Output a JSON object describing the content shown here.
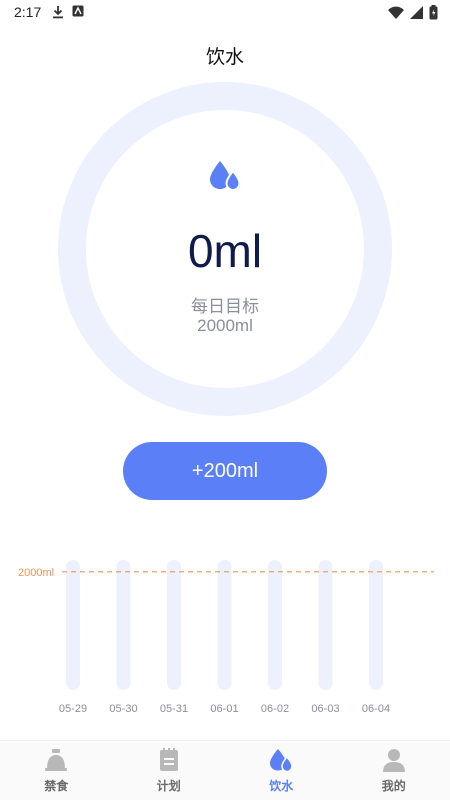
{
  "status_bar": {
    "time": "2:17"
  },
  "page": {
    "title": "饮水"
  },
  "intake": {
    "amount": "0ml",
    "goal_label": "每日目标",
    "goal_value": "2000ml",
    "progress": 0
  },
  "add_button": {
    "label": "+200ml"
  },
  "chart_data": {
    "type": "bar",
    "categories": [
      "05-29",
      "05-30",
      "05-31",
      "06-01",
      "06-02",
      "06-03",
      "06-04"
    ],
    "values": [
      0,
      0,
      0,
      0,
      0,
      0,
      0
    ],
    "goal_line": {
      "label": "2000ml",
      "value": 2000
    },
    "ylim": [
      0,
      2200
    ]
  },
  "nav": {
    "items": [
      {
        "label": "禁食",
        "icon": "fasting-icon",
        "active": false
      },
      {
        "label": "计划",
        "icon": "plan-icon",
        "active": false
      },
      {
        "label": "饮水",
        "icon": "water-drop-icon",
        "active": true
      },
      {
        "label": "我的",
        "icon": "profile-icon",
        "active": false
      }
    ]
  },
  "colors": {
    "accent": "#5b7ff7",
    "ring_track": "#edf1fe",
    "goal_line": "#f0935a",
    "nav_inactive": "#b8b8b8"
  }
}
